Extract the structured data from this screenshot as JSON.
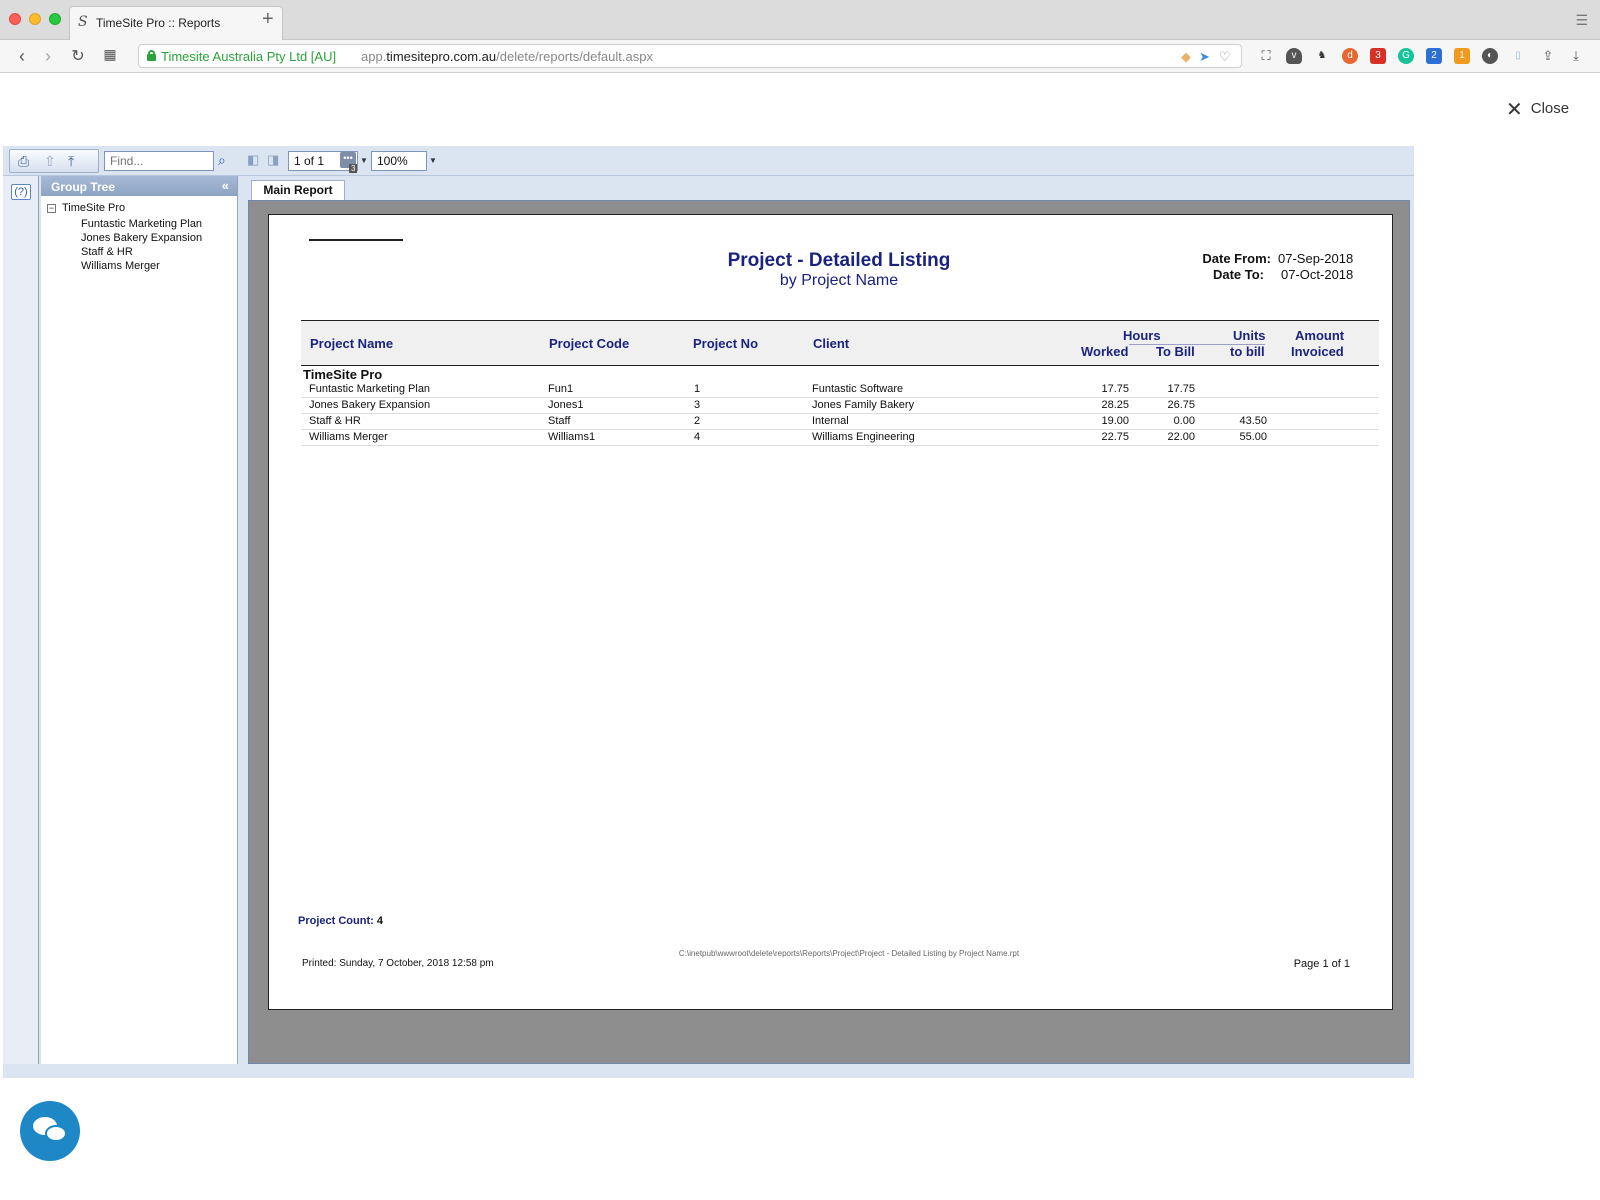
{
  "browser": {
    "tab_title": "TimeSite Pro :: Reports",
    "cert_org": "Timesite Australia Pty Ltd [AU]",
    "url_prefix": "app.",
    "url_domain": "timesitepro.com.au",
    "url_path": "/delete/reports/default.aspx"
  },
  "dialog": {
    "close_label": "Close"
  },
  "viewer": {
    "find_placeholder": "Find...",
    "page_indicator": "1 of 1",
    "page_badge": "3",
    "zoom_value": "100%",
    "help_label": "(?)",
    "group_tree_title": "Group Tree",
    "collapse_label": "«",
    "tree_root": "TimeSite Pro",
    "tree_items": [
      "Funtastic Marketing Plan",
      "Jones Bakery Expansion",
      "Staff & HR",
      "Williams Merger"
    ],
    "main_tab": "Main Report"
  },
  "report": {
    "title": "Project - Detailed Listing",
    "subtitle": "by Project Name",
    "date_from_label": "Date From:",
    "date_from_value": "07-Sep-2018",
    "date_to_label": "Date To:",
    "date_to_value": "07-Oct-2018",
    "columns": {
      "project_name": "Project Name",
      "project_code": "Project Code",
      "project_no": "Project No",
      "client": "Client",
      "hours": "Hours",
      "worked": "Worked",
      "to_bill": "To Bill",
      "units": "Units",
      "to_bill_units": "to bill",
      "amount": "Amount",
      "invoiced": "Invoiced"
    },
    "group_name": "TimeSite Pro",
    "rows": [
      {
        "name": "Funtastic Marketing Plan",
        "code": "Fun1",
        "no": "1",
        "client": "Funtastic Software",
        "worked": "17.75",
        "to_bill": "17.75",
        "units": "",
        "invoiced": ""
      },
      {
        "name": "Jones Bakery Expansion",
        "code": "Jones1",
        "no": "3",
        "client": "Jones Family Bakery",
        "worked": "28.25",
        "to_bill": "26.75",
        "units": "",
        "invoiced": ""
      },
      {
        "name": "Staff & HR",
        "code": "Staff",
        "no": "2",
        "client": "Internal",
        "worked": "19.00",
        "to_bill": "0.00",
        "units": "43.50",
        "invoiced": ""
      },
      {
        "name": "Williams Merger",
        "code": "Williams1",
        "no": "4",
        "client": "Williams Engineering",
        "worked": "22.75",
        "to_bill": "22.00",
        "units": "55.00",
        "invoiced": ""
      }
    ],
    "project_count_label": "Project Count:",
    "project_count_value": "4",
    "file_path": "C:\\inetpub\\wwwroot\\delete\\reports\\Reports\\Project\\Project - Detailed Listing by Project Name.rpt",
    "printed": "Printed: Sunday, 7 October, 2018  12:58 pm",
    "page_label": "Page 1 of 1"
  },
  "colors": {
    "report_blue": "#1a237e",
    "viewer_bg": "#dbe4f1",
    "chat_blue": "#1e88c7"
  }
}
